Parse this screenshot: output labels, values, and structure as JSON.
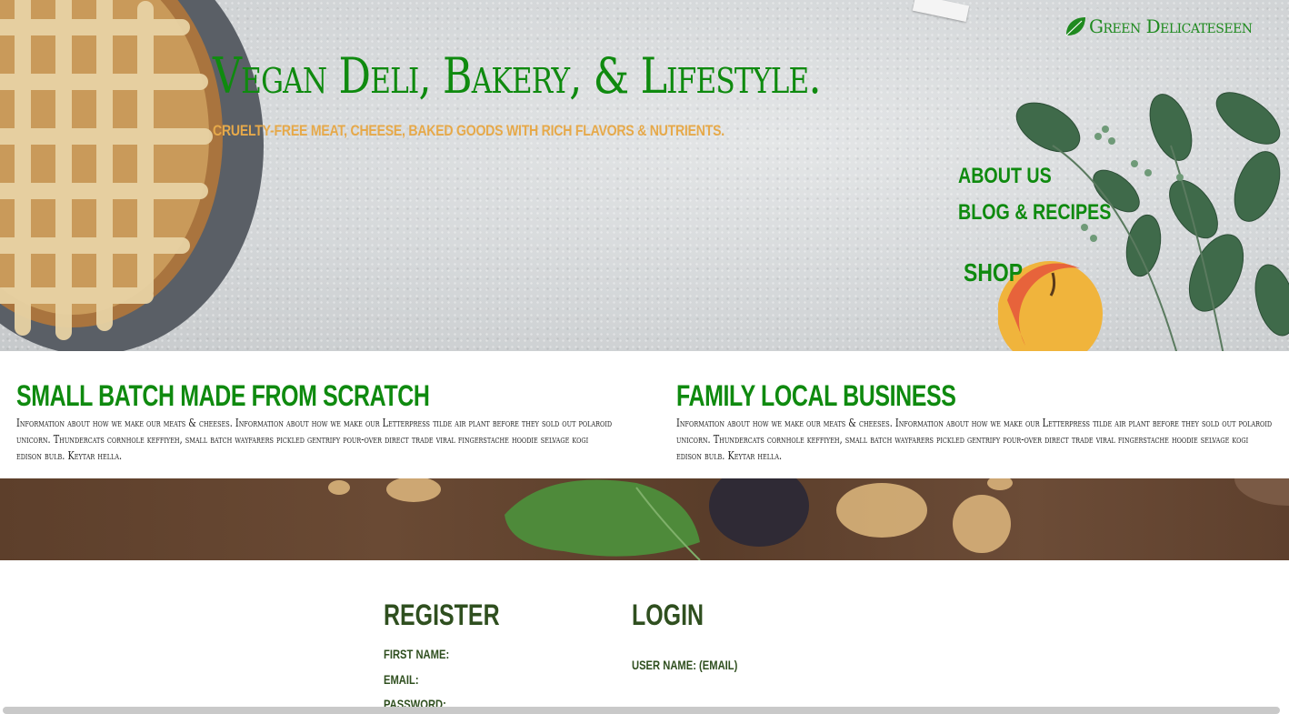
{
  "header": {
    "brand_name": "Green Delicateseen",
    "brand_icon": "leaf-icon",
    "title": "Vegan Deli, Bakery, & Lifestyle.",
    "subtitle": "Cruelty-free meat, cheese, baked goods with rich flavors & nutrients."
  },
  "nav": {
    "items": [
      {
        "label": "About Us"
      },
      {
        "label": "Blog & Recipes"
      },
      {
        "label": "Shop"
      }
    ]
  },
  "features": [
    {
      "heading": "Small Batch Made From Scratch",
      "text": "Information about how we make our meats & cheeses. Information about how we make our Letterpress tilde air plant before they sold out polaroid unicorn. Thundercats cornhole keffiyeh, small batch wayfarers pickled gentrify pour-over direct trade viral fingerstache hoodie selvage kogi edison bulb. Keytar hella."
    },
    {
      "heading": "Family Local Business",
      "text": "Information about how we make our meats & cheeses. Information about how we make our Letterpress tilde air plant before they sold out polaroid unicorn. Thundercats cornhole keffiyeh, small batch wayfarers pickled gentrify pour-over direct trade viral fingerstache hoodie selvage kogi edison bulb. Keytar hella."
    }
  ],
  "register": {
    "title": "Register",
    "fields": [
      "First Name:",
      "Email:",
      "Password:"
    ]
  },
  "login": {
    "title": "Login",
    "fields": [
      "User Name: (email)"
    ]
  },
  "colors": {
    "accent_green": "#0f8a0f",
    "subtitle_orange": "#e6a94a",
    "form_text": "#2f4f1f"
  }
}
